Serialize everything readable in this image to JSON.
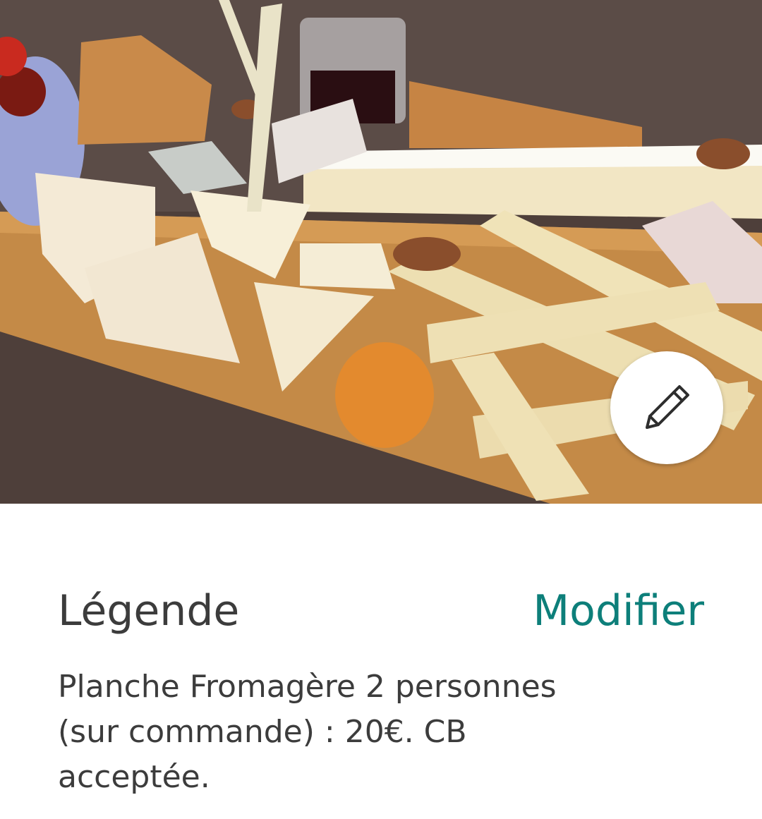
{
  "photo": {
    "subject": "cheese-board-photo"
  },
  "edit_button": {
    "icon": "pencil-icon"
  },
  "caption": {
    "title": "Légende",
    "edit_label": "Modifier",
    "text": "Planche Fromagère 2 personnes (sur commande) : 20€. CB acceptée."
  },
  "colors": {
    "accent": "#0d7f7a",
    "text": "#3c3c3c",
    "background": "#ffffff"
  }
}
